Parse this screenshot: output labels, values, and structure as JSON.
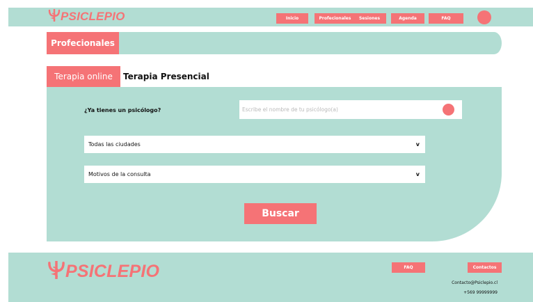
{
  "brand": {
    "name": "PSICLEPIO",
    "logo_icon": "caduceus-icon"
  },
  "colors": {
    "mint": "#b2ddd3",
    "coral": "#f57376"
  },
  "nav": {
    "items": [
      {
        "label": "Inicio"
      },
      {
        "label": "Profecionales"
      },
      {
        "label": "Sesiones"
      },
      {
        "label": "Agenda"
      },
      {
        "label": "FAQ"
      }
    ]
  },
  "section": {
    "title": "Profecionales"
  },
  "tabs": [
    {
      "label": "Terapia online",
      "active": true
    },
    {
      "label": "Terapia Presencial",
      "active": false
    }
  ],
  "search": {
    "question": "¿Ya tienes un psicólogo?",
    "placeholder": "Escribe el nombre de tu psicólogo(a)",
    "value": ""
  },
  "filters": {
    "city": {
      "selected": "Todas las ciudades",
      "chevron": "v"
    },
    "reason": {
      "selected": "Motivos de la consulta",
      "chevron": "v"
    }
  },
  "actions": {
    "search_label": "Buscar"
  },
  "footer": {
    "faq_label": "FAQ",
    "contacts_label": "Contactos",
    "email": "Contacto@Psiclepio.cl",
    "phone": "+569 99999999"
  }
}
